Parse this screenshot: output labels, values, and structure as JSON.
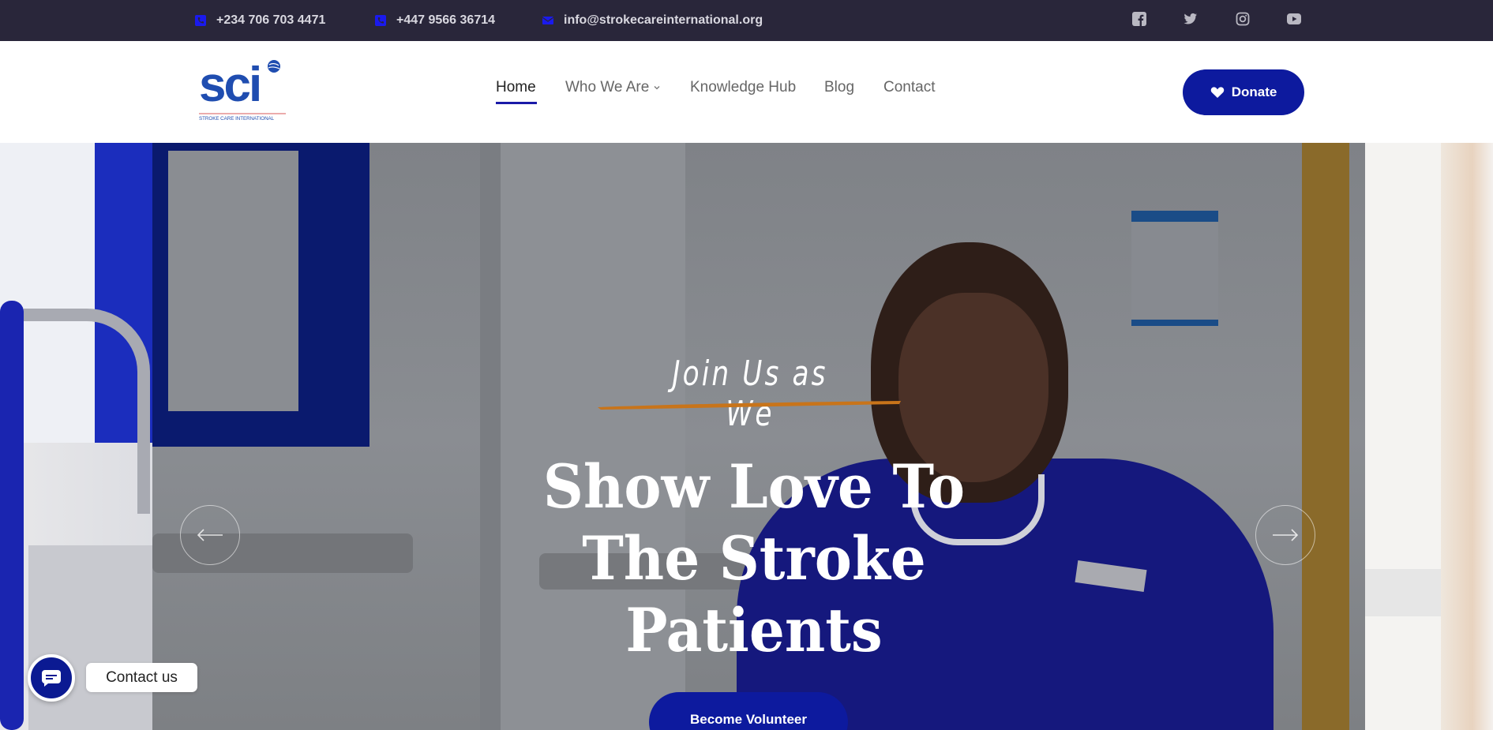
{
  "topbar": {
    "phone1": "+234 706 703 4471",
    "phone2": "+447 9566 36714",
    "email": "info@strokecareinternational.org",
    "social": [
      "facebook-icon",
      "twitter-icon",
      "instagram-icon",
      "youtube-icon"
    ]
  },
  "header": {
    "logo_text": "sci",
    "logo_subtext": "STROKE CARE INTERNATIONAL",
    "nav": {
      "home": "Home",
      "who": "Who We Are",
      "knowledge": "Knowledge Hub",
      "blog": "Blog",
      "contact": "Contact"
    },
    "donate_label": "Donate"
  },
  "hero": {
    "tagline": "Join Us as We",
    "headline": "Show Love To The Stroke Patients",
    "cta_label": "Become Volunteer",
    "prev_arrow": "arrow-left-icon",
    "next_arrow": "arrow-right-icon"
  },
  "widget": {
    "contact_label": "Contact us"
  },
  "colors": {
    "topbar_bg": "#29263a",
    "accent_blue": "#0d1a9e",
    "brush_orange": "#c8741a"
  }
}
